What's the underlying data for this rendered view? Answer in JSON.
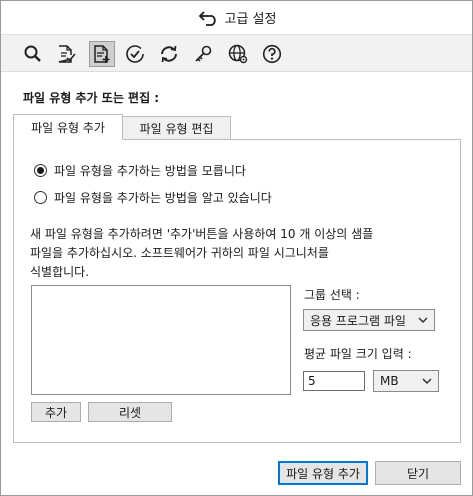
{
  "window": {
    "title": "고급 설정"
  },
  "toolbar": {
    "tools": [
      {
        "icon": "search-icon"
      },
      {
        "icon": "document-check-icon"
      },
      {
        "icon": "document-add-icon",
        "active": true
      },
      {
        "icon": "circle-check-icon"
      },
      {
        "icon": "refresh-icon"
      },
      {
        "icon": "key-icon"
      },
      {
        "icon": "globe-settings-icon"
      },
      {
        "icon": "help-icon"
      }
    ]
  },
  "section_title": "파일 유형 추가 또는 편집 :",
  "tabs": [
    {
      "label": "파일 유형 추가",
      "active": true
    },
    {
      "label": "파일 유형 편집",
      "active": false
    }
  ],
  "radios": [
    {
      "label": "파일 유형을 추가하는 방법을 모릅니다",
      "checked": true
    },
    {
      "label": "파일 유형을 추가하는 방법을 알고 있습니다",
      "checked": false
    }
  ],
  "description": {
    "line1": "새 파일 유형을 추가하려면 '추가'버튼을 사용하여 10 개 이상의 샘플",
    "line2": "파일을 추가하십시오. 소프트웨어가 귀하의 파일 시그니처를",
    "line3": "식별합니다."
  },
  "buttons": {
    "add": "추가",
    "reset": "리셋",
    "add_file_type": "파일 유형 추가",
    "close": "닫기"
  },
  "group": {
    "label": "그룹 선택 :",
    "selected": "응용 프로그램 파일"
  },
  "avg_size": {
    "label": "평균 파일 크기 입력 :",
    "value": "5",
    "unit": "MB"
  },
  "colors": {
    "accent": "#0078d7",
    "active_tool_bg": "#cfcfcf"
  }
}
